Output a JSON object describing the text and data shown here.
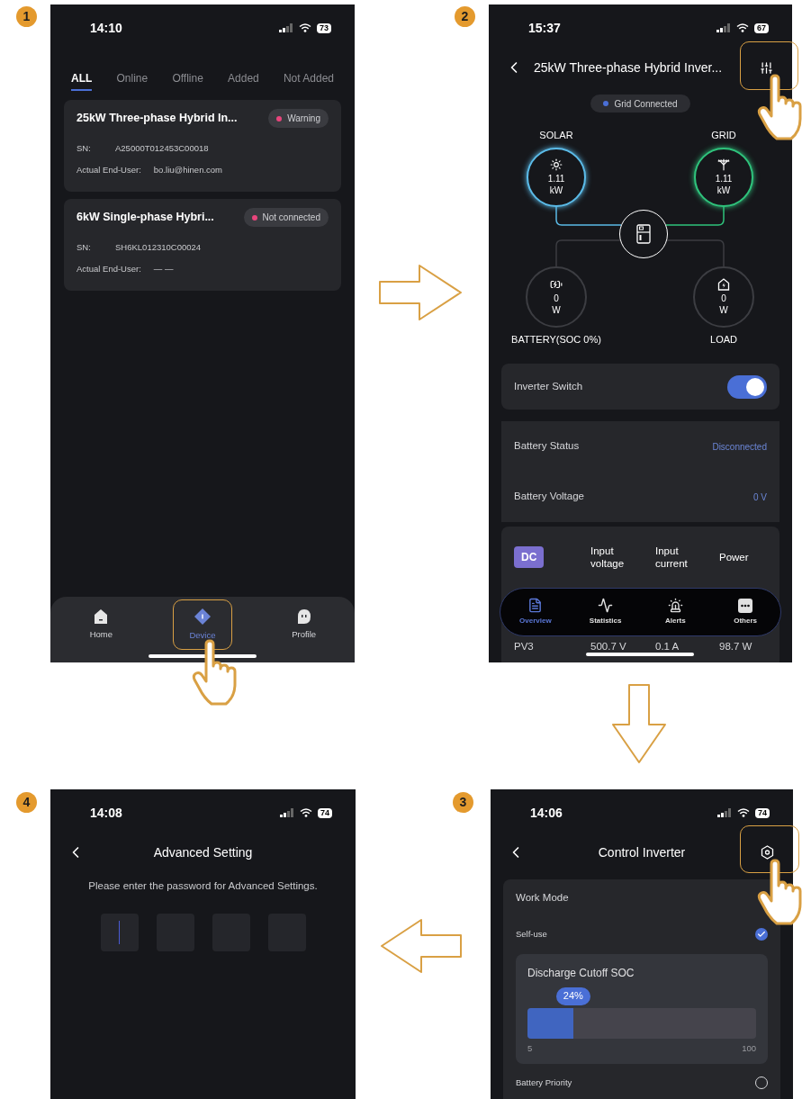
{
  "screens": [
    {
      "kind": "device_list",
      "step": "1",
      "status_bar": {
        "time": "14:10",
        "battery": "73"
      },
      "tabs": [
        {
          "label": "ALL",
          "selected": true
        },
        {
          "label": "Online",
          "selected": false
        },
        {
          "label": "Offline",
          "selected": false
        },
        {
          "label": "Added",
          "selected": false
        },
        {
          "label": "Not Added",
          "selected": false
        }
      ],
      "devices": [
        {
          "name": "25kW Three-phase Hybrid In...",
          "status": "Warning",
          "color": "#e8457c",
          "fields": [
            {
              "label": "SN:",
              "value": "A25000T012453C00018"
            },
            {
              "label": "Actual End-User:",
              "value": "bo.liu@hinen.com"
            }
          ]
        },
        {
          "name": "6kW Single-phase Hybri...",
          "status": "Not connected",
          "color": "#e8457c",
          "fields": [
            {
              "label": "SN:",
              "value": "SH6KL012310C00024"
            },
            {
              "label": "Actual End-User:",
              "value": "— —"
            }
          ]
        }
      ],
      "nav": [
        {
          "kind": "home",
          "label": "Home",
          "selected": false
        },
        {
          "kind": "device",
          "label": "Device",
          "selected": true
        },
        {
          "kind": "profile",
          "label": "Profile",
          "selected": false
        }
      ]
    },
    {
      "kind": "device_overview",
      "step": "2",
      "status_bar": {
        "time": "15:37",
        "battery": "67"
      },
      "title": "25kW Three-phase Hybrid Inver...",
      "grid_status": {
        "label": "Grid Connected",
        "color": "#4a6fd6"
      },
      "nodes": [
        {
          "kind": "solar",
          "label": "SOLAR",
          "value": "1.11",
          "unit": "kW",
          "color": "#5bbbe8"
        },
        {
          "kind": "grid",
          "label": "GRID",
          "value": "1.11",
          "unit": "kW",
          "color": "#2fc37c"
        },
        {
          "kind": "battery",
          "label": "BATTERY(SOC 0%)",
          "value": "0",
          "unit": "W",
          "color": "#3c3d42"
        },
        {
          "kind": "load",
          "label": "LOAD",
          "value": "0",
          "unit": "W",
          "color": "#3c3d42"
        }
      ],
      "inverter_switch": {
        "label": "Inverter Switch",
        "on": true
      },
      "battery": [
        {
          "label": "Battery Status",
          "value": "Disconnected"
        },
        {
          "label": "Battery Voltage",
          "value": "0 V"
        }
      ],
      "dc_table": {
        "columns": [
          {
            "kind": "badge",
            "label": "DC"
          },
          {
            "kind": "text",
            "label": "Input voltage"
          },
          {
            "kind": "text",
            "label": "Input current"
          },
          {
            "kind": "text",
            "label": "Power"
          }
        ],
        "rows": [
          [
            "PV3",
            "500.7 V",
            "0.1 A",
            "98.7 W"
          ]
        ]
      },
      "tabbar": [
        {
          "kind": "overview",
          "label": "Overview",
          "selected": true
        },
        {
          "kind": "statistics",
          "label": "Statistics",
          "selected": false
        },
        {
          "kind": "alerts",
          "label": "Alerts",
          "selected": false
        },
        {
          "kind": "others",
          "label": "Others",
          "selected": false
        }
      ]
    },
    {
      "kind": "advanced_setting",
      "step": "4",
      "status_bar": {
        "time": "14:08",
        "battery": "74"
      },
      "title": "Advanced Setting",
      "prompt": "Please enter the password for Advanced Settings.",
      "code_boxes": [
        {
          "focused": true
        },
        {
          "focused": false
        },
        {
          "focused": false
        },
        {
          "focused": false
        }
      ]
    },
    {
      "kind": "control_inverter",
      "step": "3",
      "status_bar": {
        "time": "14:06",
        "battery": "74"
      },
      "title": "Control Inverter",
      "section": "Work Mode",
      "modes": [
        {
          "label": "Self-use",
          "selected": true
        },
        {
          "label": "Battery Priority",
          "selected": false
        }
      ],
      "cutoff": {
        "label": "Discharge Cutoff SOC",
        "reading": "24%",
        "level": 0.2,
        "min": "5",
        "max": "100"
      }
    }
  ]
}
